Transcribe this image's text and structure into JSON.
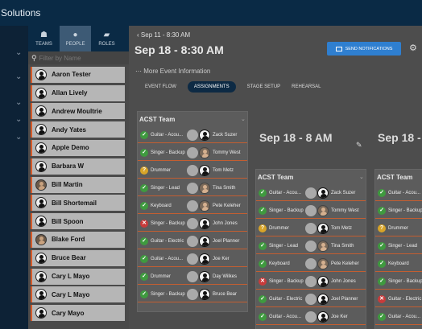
{
  "app": {
    "title": "Solutions"
  },
  "sidebar": {
    "tabs": [
      {
        "label": "TEAMS",
        "icon": "team-icon"
      },
      {
        "label": "PEOPLE",
        "icon": "person-icon"
      },
      {
        "label": "ROLES",
        "icon": "tag-icon"
      }
    ],
    "filter_placeholder": "Filter by Name",
    "people": [
      "Aaron Tester",
      "Allan Lively",
      "Andrew Moultrie",
      "Andy Yates",
      "Apple Demo",
      "Barbara W",
      "Bill Martin",
      "Bill Shortemail",
      "Bill Spoon",
      "Blake Ford",
      "Bruce Bear",
      "Cary L Mayo",
      "Cary L Mayo",
      "Cary Mayo"
    ]
  },
  "event": {
    "breadcrumb": "Sep 11 - 8:30 AM",
    "title": "Sep 18 - 8:30 AM",
    "notify_label": "SEND NOTIFICATIONS",
    "more_info": "More Event Information",
    "tabs": [
      "EVENT FLOW",
      "ASSIGNMENTS",
      "STAGE SETUP",
      "REHEARSAL"
    ]
  },
  "columns": [
    {
      "heading": "",
      "team": "ACST Team"
    },
    {
      "heading": "Sep 18 - 8 AM",
      "team": "ACST Team"
    },
    {
      "heading": "Sep 18 -",
      "team": "ACST Team"
    }
  ],
  "col1_assignments": [
    {
      "status": "ok",
      "role": "Guitar - Acou...",
      "person": "Zack Suzer"
    },
    {
      "status": "ok",
      "role": "Singer - Backup",
      "person": "Tommy West"
    },
    {
      "status": "q",
      "role": "Drummer",
      "person": "Tom Metz"
    },
    {
      "status": "ok",
      "role": "Singer - Lead",
      "person": "Tina Smith"
    },
    {
      "status": "ok",
      "role": "Keyboard",
      "person": "Pete Keleher"
    },
    {
      "status": "x",
      "role": "Singer - Backup",
      "person": "John Jones"
    },
    {
      "status": "ok",
      "role": "Guitar - Electric",
      "person": "Joel Planner"
    },
    {
      "status": "ok",
      "role": "Guitar - Acou...",
      "person": "Joe Ker"
    },
    {
      "status": "ok",
      "role": "Drummer",
      "person": "Day Wilkes"
    },
    {
      "status": "ok",
      "role": "Singer - Backup",
      "person": "Bruce Bear"
    }
  ],
  "col2_assignments": [
    {
      "status": "ok",
      "role": "Guitar - Acou...",
      "person": "Zack Suzer"
    },
    {
      "status": "ok",
      "role": "Singer - Backup",
      "person": "Tommy West"
    },
    {
      "status": "q",
      "role": "Drummer",
      "person": "Tom Metz"
    },
    {
      "status": "ok",
      "role": "Singer - Lead",
      "person": "Tina Smith"
    },
    {
      "status": "ok",
      "role": "Keyboard",
      "person": "Pete Keleher"
    },
    {
      "status": "x",
      "role": "Singer - Backup",
      "person": "John Jones"
    },
    {
      "status": "ok",
      "role": "Guitar - Electric",
      "person": "Joel Planner"
    },
    {
      "status": "ok",
      "role": "Guitar - Acou...",
      "person": "Joe Ker"
    }
  ],
  "col3_assignments": [
    {
      "status": "ok",
      "role": "Guitar - Acou..."
    },
    {
      "status": "ok",
      "role": "Singer - Backup"
    },
    {
      "status": "q",
      "role": "Drummer"
    },
    {
      "status": "ok",
      "role": "Singer - Lead"
    },
    {
      "status": "ok",
      "role": "Keyboard"
    },
    {
      "status": "ok",
      "role": "Singer - Backup"
    },
    {
      "status": "x",
      "role": "Guitar - Electric"
    },
    {
      "status": "ok",
      "role": "Guitar - Acou..."
    }
  ],
  "colors": {
    "accent": "#2f7fd0",
    "topbar": "#0a2a45",
    "ok": "#3f9a3f",
    "pending": "#d8a428",
    "declined": "#c83b3b",
    "slot_underline": "#c35e31"
  }
}
